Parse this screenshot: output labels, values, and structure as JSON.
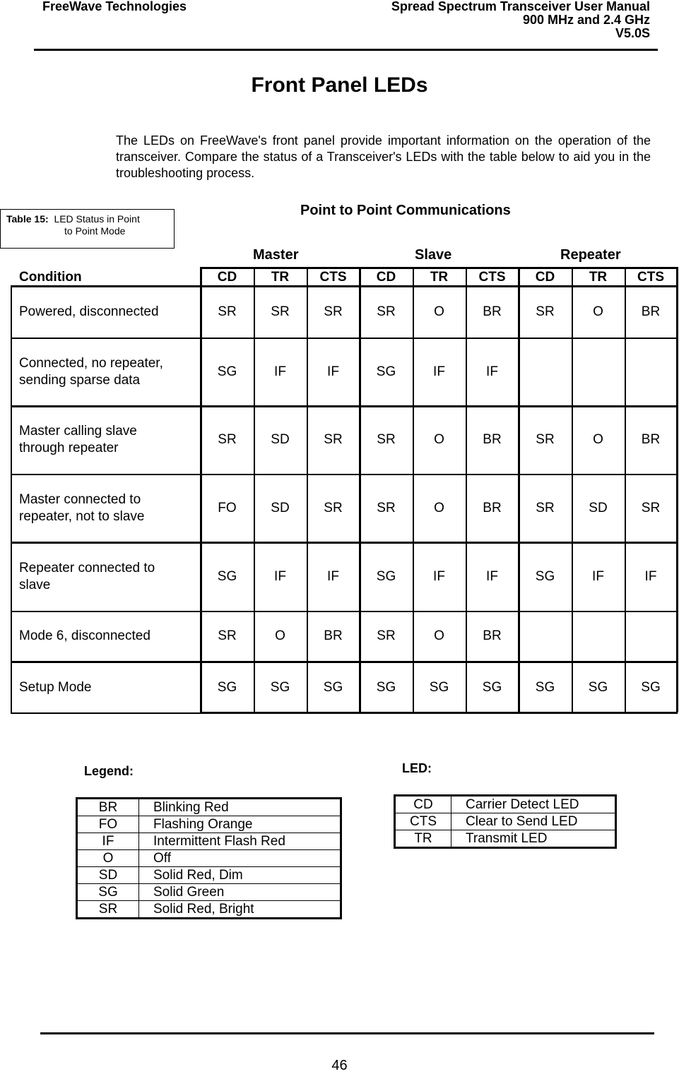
{
  "header": {
    "company": "FreeWave Technologies",
    "manual_title": "Spread Spectrum Transceiver User Manual",
    "frequency": "900 MHz and 2.4 GHz",
    "version": "V5.0S"
  },
  "section_title": "Front Panel LEDs",
  "intro": "The LEDs on FreeWave's front panel provide important information on the operation of the transceiver.  Compare the status of a Transceiver's LEDs with the table below to aid you in the troubleshooting process.",
  "table_label": {
    "number": "Table 15:",
    "line1": "LED Status in Point",
    "line2": "to Point Mode"
  },
  "table": {
    "title": "Point to Point Communications",
    "groups": [
      "Master",
      "Slave",
      "Repeater"
    ],
    "condition_header": "Condition",
    "columns": [
      "CD",
      "TR",
      "CTS",
      "CD",
      "TR",
      "CTS",
      "CD",
      "TR",
      "CTS"
    ],
    "rows": [
      {
        "condition": [
          "Powered, disconnected"
        ],
        "values": [
          "SR",
          "SR",
          "SR",
          "SR",
          "O",
          "BR",
          "SR",
          "O",
          "BR"
        ]
      },
      {
        "condition": [
          "Connected, no repeater,",
          "sending sparse data"
        ],
        "values": [
          "SG",
          "IF",
          "IF",
          "SG",
          "IF",
          "IF",
          "",
          "",
          ""
        ]
      },
      {
        "condition": [
          "Master calling slave",
          "through repeater"
        ],
        "values": [
          "SR",
          "SD",
          "SR",
          "SR",
          "O",
          "BR",
          "SR",
          "O",
          "BR"
        ]
      },
      {
        "condition": [
          "Master connected to",
          "repeater, not to slave"
        ],
        "values": [
          "FO",
          "SD",
          "SR",
          "SR",
          "O",
          "BR",
          "SR",
          "SD",
          "SR"
        ]
      },
      {
        "condition": [
          "Repeater connected to",
          "slave"
        ],
        "values": [
          "SG",
          "IF",
          "IF",
          "SG",
          "IF",
          "IF",
          "SG",
          "IF",
          "IF"
        ]
      },
      {
        "condition": [
          "Mode 6, disconnected"
        ],
        "values": [
          "SR",
          "O",
          "BR",
          "SR",
          "O",
          "BR",
          "",
          "",
          ""
        ]
      },
      {
        "condition": [
          "Setup Mode"
        ],
        "values": [
          "SG",
          "SG",
          "SG",
          "SG",
          "SG",
          "SG",
          "SG",
          "SG",
          "SG"
        ]
      }
    ]
  },
  "legend": {
    "label": "Legend:",
    "items": [
      {
        "code": "BR",
        "meaning": "Blinking Red"
      },
      {
        "code": "FO",
        "meaning": "Flashing Orange"
      },
      {
        "code": "IF",
        "meaning": "Intermittent Flash Red"
      },
      {
        "code": "O",
        "meaning": "Off"
      },
      {
        "code": "SD",
        "meaning": "Solid Red, Dim"
      },
      {
        "code": "SG",
        "meaning": "Solid Green"
      },
      {
        "code": "SR",
        "meaning": "Solid Red, Bright"
      }
    ]
  },
  "led_key": {
    "label": "LED:",
    "items": [
      {
        "code": "CD",
        "meaning": "Carrier Detect LED"
      },
      {
        "code": "CTS",
        "meaning": "Clear to Send LED"
      },
      {
        "code": "TR",
        "meaning": "Transmit LED"
      }
    ]
  },
  "page_number": "46"
}
